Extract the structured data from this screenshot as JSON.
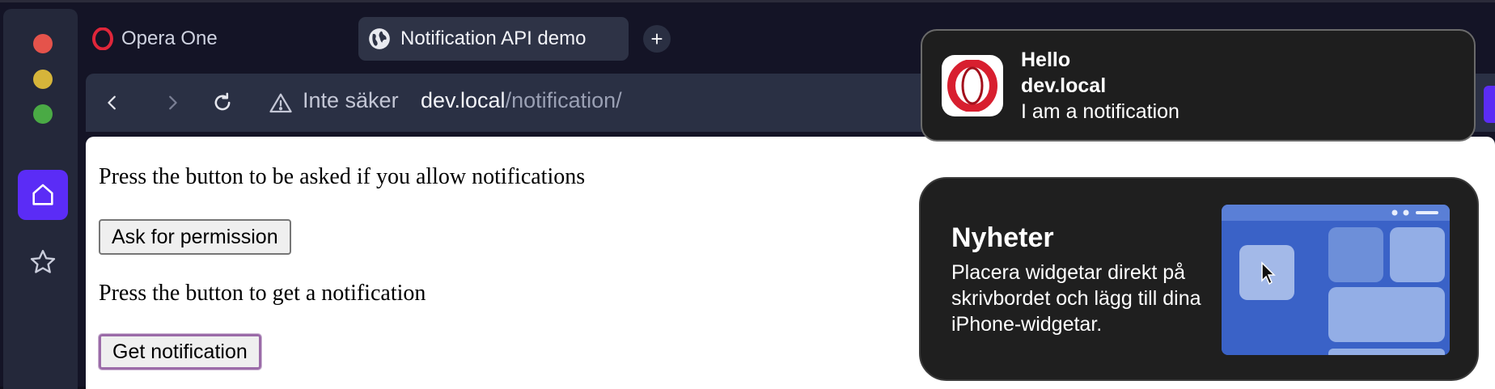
{
  "tabs": [
    {
      "label": "Opera One",
      "icon": "opera-logo-icon",
      "active": false
    },
    {
      "label": "Notification API demo",
      "icon": "globe-icon",
      "active": true
    }
  ],
  "new_tab_label": "+",
  "address_bar": {
    "security_label": "Inte säker",
    "url_host": "dev.local",
    "url_path": "/notification/"
  },
  "page": {
    "line1": "Press the button to be asked if you allow notifications",
    "button1": "Ask for permission",
    "line2": "Press the button to get a notification",
    "button2": "Get notification"
  },
  "notification": {
    "title": "Hello",
    "origin": "dev.local",
    "body": "I am a notification"
  },
  "widget": {
    "title": "Nyheter",
    "description": "Placera widgetar direkt på skrivbordet och lägg till dina iPhone-widgetar."
  },
  "colors": {
    "accent": "#5b2cf6",
    "opera_red": "#e0263a",
    "toolbar": "#2a3044",
    "window_bg": "#141426"
  }
}
